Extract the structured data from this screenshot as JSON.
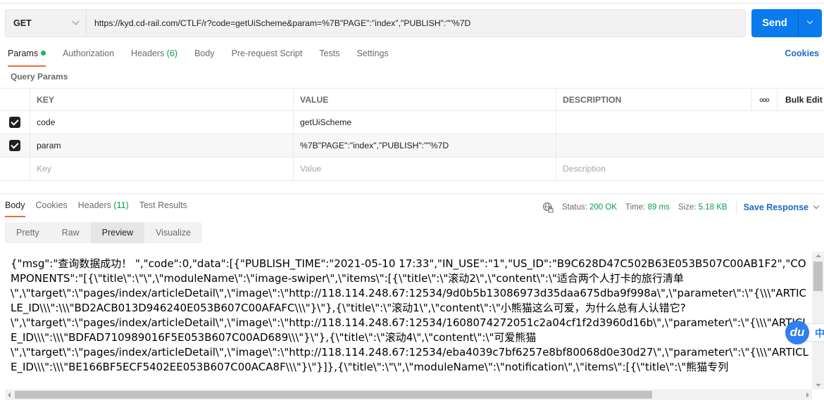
{
  "request": {
    "method": "GET",
    "url": "https://kyd.cd-rail.com/CTLF/r?code=getUiScheme&param=%7B\"PAGE\":\"index\",\"PUBLISH\":\"\"%7D",
    "send_label": "Send"
  },
  "request_tabs": [
    {
      "label": "Params",
      "active": true,
      "indicator": "green-dot"
    },
    {
      "label": "Authorization"
    },
    {
      "label": "Headers",
      "count": "(6)"
    },
    {
      "label": "Body"
    },
    {
      "label": "Pre-request Script"
    },
    {
      "label": "Tests"
    },
    {
      "label": "Settings"
    }
  ],
  "cookies_link": "Cookies",
  "query_params": {
    "section_label": "Query Params",
    "columns": {
      "key": "KEY",
      "value": "VALUE",
      "description": "DESCRIPTION",
      "more": "ooo",
      "bulk_edit": "Bulk Edit"
    },
    "rows": [
      {
        "checked": true,
        "key": "code",
        "value": "getUiScheme",
        "description": ""
      },
      {
        "checked": true,
        "key": "param",
        "value": "%7B\"PAGE\":\"index\",\"PUBLISH\":\"\"%7D",
        "description": ""
      }
    ],
    "placeholders": {
      "key": "Key",
      "value": "Value",
      "description": "Description"
    }
  },
  "response_tabs": [
    {
      "label": "Body",
      "active": true
    },
    {
      "label": "Cookies"
    },
    {
      "label": "Headers",
      "count": "(11)"
    },
    {
      "label": "Test Results"
    }
  ],
  "response_status": {
    "status_label": "Status:",
    "status_value": "200 OK",
    "time_label": "Time:",
    "time_value": "89 ms",
    "size_label": "Size:",
    "size_value": "5.18 KB",
    "save_response": "Save Response"
  },
  "view_modes": [
    {
      "label": "Pretty"
    },
    {
      "label": "Raw"
    },
    {
      "label": "Preview",
      "active": true
    },
    {
      "label": "Visualize"
    }
  ],
  "preview_body": "{\"msg\":\"查询数据成功！ \",\"code\":0,\"data\":[{\"PUBLISH_TIME\":\"2021-05-10 17:33\",\"IN_USE\":\"1\",\"US_ID\":\"B9C628D47C502B63E053B507C00AB1F2\",\"COMPONENTS\":\"[{\\\"title\\\":\\\"\\\",\\\"moduleName\\\":\\\"image-swiper\\\",\\\"items\\\":[{\\\"title\\\":\\\"滚动2\\\",\\\"content\\\":\\\"适合两个人打卡的旅行清单\n\\\",\\\"target\\\":\\\"pages/index/articleDetail\\\",\\\"image\\\":\\\"http://118.114.248.67:12534/9d0b5b13086973d35daa675dba9f998a\\\",\\\"parameter\\\":\\\"{\\\\\\\"ARTICLE_ID\\\\\\\":\\\\\\\"BD2ACB013D946240E053B607C00AFAFC\\\\\\\"}\\\"},{\\\"title\\\":\\\"滚动1\\\",\\\"content\\\":\\\"小熊猫这么可爱，为什么总有人认错它?\n\\\",\\\"target\\\":\\\"pages/index/articleDetail\\\",\\\"image\\\":\\\"http://118.114.248.67:12534/1608074272051c2a04cf1f2d3960d16b\\\",\\\"parameter\\\":\\\"{\\\\\\\"ARTICLE_ID\\\\\\\":\\\\\\\"BDFAD710989016F5E053B607C00AD689\\\\\\\"}\\\"},{\\\"title\\\":\\\"滚动4\\\",\\\"content\\\":\\\"可爱熊猫\n\\\",\\\"target\\\":\\\"pages/index/articleDetail\\\",\\\"image\\\":\\\"http://118.114.248.67:12534/eba4039c7bf6257e8bf80068d0e30d27\\\",\\\"parameter\\\":\\\"{\\\\\\\"ARTICLE_ID\\\\\\\":\\\\\\\"BE166BF5ECF5402EE053B607C00ACA8F\\\\\\\"}\\\"}]},{\\\"title\\\":\\\"\\\",\\\"moduleName\\\":\\\"notification\\\",\\\"items\\\":[{\\\"title\\\":\\\"熊猫专列",
  "overlay_widget": {
    "logo": "du",
    "text": "中"
  },
  "colors": {
    "accent_blue": "#097bed",
    "link_blue": "#1b69c9",
    "active_underline": "#f26b3a",
    "status_green": "#0a9c4a"
  }
}
